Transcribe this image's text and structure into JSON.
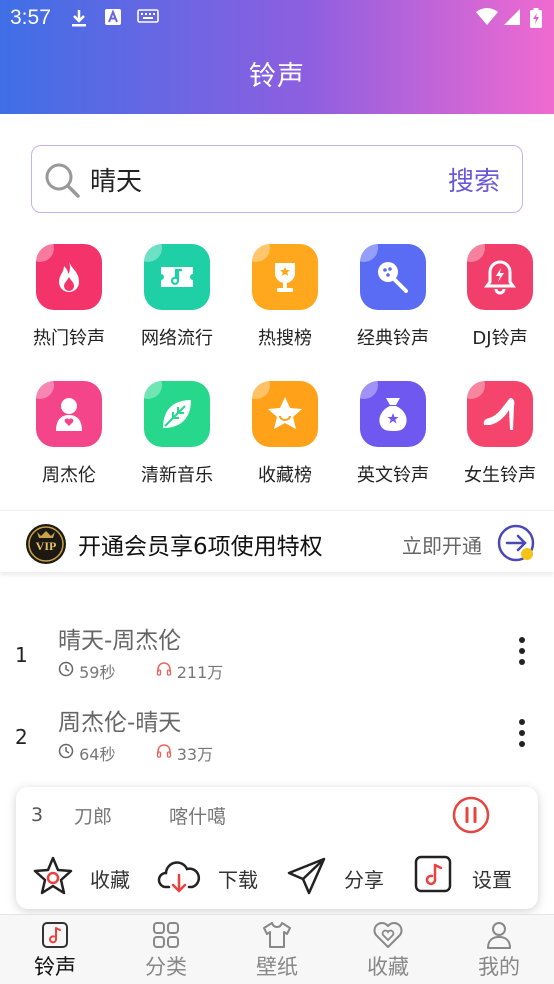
{
  "status_bar": {
    "time": "3:57"
  },
  "header": {
    "title": "铃声"
  },
  "search": {
    "query": "晴天",
    "button_label": "搜索"
  },
  "categories": [
    {
      "label": "热门铃声",
      "icon": "fire-icon",
      "color": "#f4336a"
    },
    {
      "label": "网络流行",
      "icon": "ticket-icon",
      "color": "#1fcfa6"
    },
    {
      "label": "热搜榜",
      "icon": "trophy-icon",
      "color": "#ffa81e"
    },
    {
      "label": "经典铃声",
      "icon": "microphone-icon",
      "color": "#5a6cf4"
    },
    {
      "label": "DJ铃声",
      "icon": "bell-icon",
      "color": "#f23e6b"
    },
    {
      "label": "周杰伦",
      "icon": "person-icon",
      "color": "#f4458a"
    },
    {
      "label": "清新音乐",
      "icon": "leaf-icon",
      "color": "#27d88c"
    },
    {
      "label": "收藏榜",
      "icon": "star-icon",
      "color": "#ffa21a"
    },
    {
      "label": "英文铃声",
      "icon": "money-bag-icon",
      "color": "#6f58f0"
    },
    {
      "label": "女生铃声",
      "icon": "high-heel-icon",
      "color": "#f5456c"
    }
  ],
  "vip": {
    "badge": "VIP",
    "text": "开通会员享6项使用特权",
    "link": "立即开通"
  },
  "songs": [
    {
      "rank": "1",
      "title": "晴天-周杰伦",
      "duration": "59秒",
      "plays": "211万"
    },
    {
      "rank": "2",
      "title": "周杰伦-晴天",
      "duration": "64秒",
      "plays": "33万"
    }
  ],
  "player": {
    "rank": "3",
    "marquee": "刀郎　　　喀什噶尔",
    "actions": {
      "favorite": "收藏",
      "download": "下载",
      "share": "分享",
      "settings": "设置"
    }
  },
  "bottom_nav": [
    {
      "label": "铃声",
      "active": true
    },
    {
      "label": "分类",
      "active": false
    },
    {
      "label": "壁纸",
      "active": false
    },
    {
      "label": "收藏",
      "active": false
    },
    {
      "label": "我的",
      "active": false
    }
  ],
  "colors": {
    "accent": "#6b58d8",
    "header_start": "#3f6fe6",
    "header_end": "#f06ad0",
    "player_red": "#e8433f"
  }
}
